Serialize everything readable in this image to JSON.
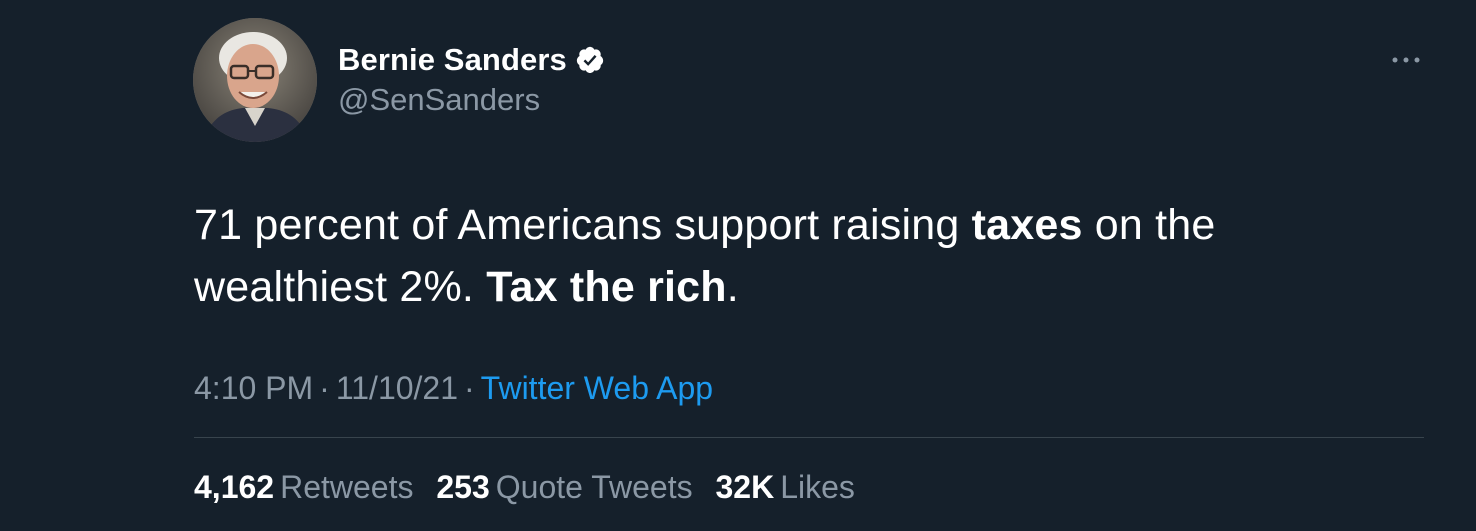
{
  "author": {
    "display_name": "Bernie Sanders",
    "handle": "@SenSanders",
    "verified": true,
    "avatar_icon": "profile-photo"
  },
  "tweet": {
    "segments": [
      {
        "text": "71 percent of Americans support raising ",
        "bold": false
      },
      {
        "text": "taxes",
        "bold": true
      },
      {
        "text": " on the wealthiest 2%. ",
        "bold": false
      },
      {
        "text": "Tax the rich",
        "bold": true
      },
      {
        "text": ".",
        "bold": false
      }
    ]
  },
  "meta": {
    "time": "4:10 PM",
    "separator": "·",
    "date": "11/10/21",
    "source": "Twitter Web App"
  },
  "stats": {
    "retweets_count": "4,162",
    "retweets_label": "Retweets",
    "quotes_count": "253",
    "quotes_label": "Quote Tweets",
    "likes_count": "32K",
    "likes_label": "Likes"
  },
  "colors": {
    "background": "#15202b",
    "primary_text": "#ffffff",
    "secondary_text": "#8b98a5",
    "link": "#1d9bf0",
    "divider": "#38444d"
  }
}
